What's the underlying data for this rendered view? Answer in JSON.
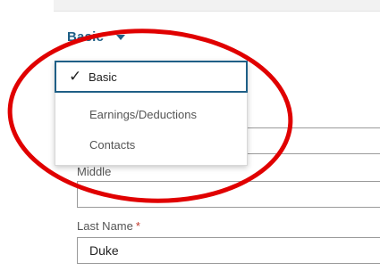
{
  "section_selector": {
    "label": "Basic",
    "icon": "caret-down-icon"
  },
  "menu": {
    "items": [
      {
        "label": "Basic",
        "selected": true,
        "icon": "checkmark-icon"
      },
      {
        "label": "Earnings/Deductions",
        "selected": false
      },
      {
        "label": "Contacts",
        "selected": false
      }
    ]
  },
  "form": {
    "middle_label": "Middle",
    "middle_value": "",
    "last_name_label": "Last Name",
    "required_marker": "*",
    "last_name_value": "Duke"
  },
  "colors": {
    "accent": "#1f5f86",
    "required": "#c0392b",
    "annotation": "#e00000"
  }
}
